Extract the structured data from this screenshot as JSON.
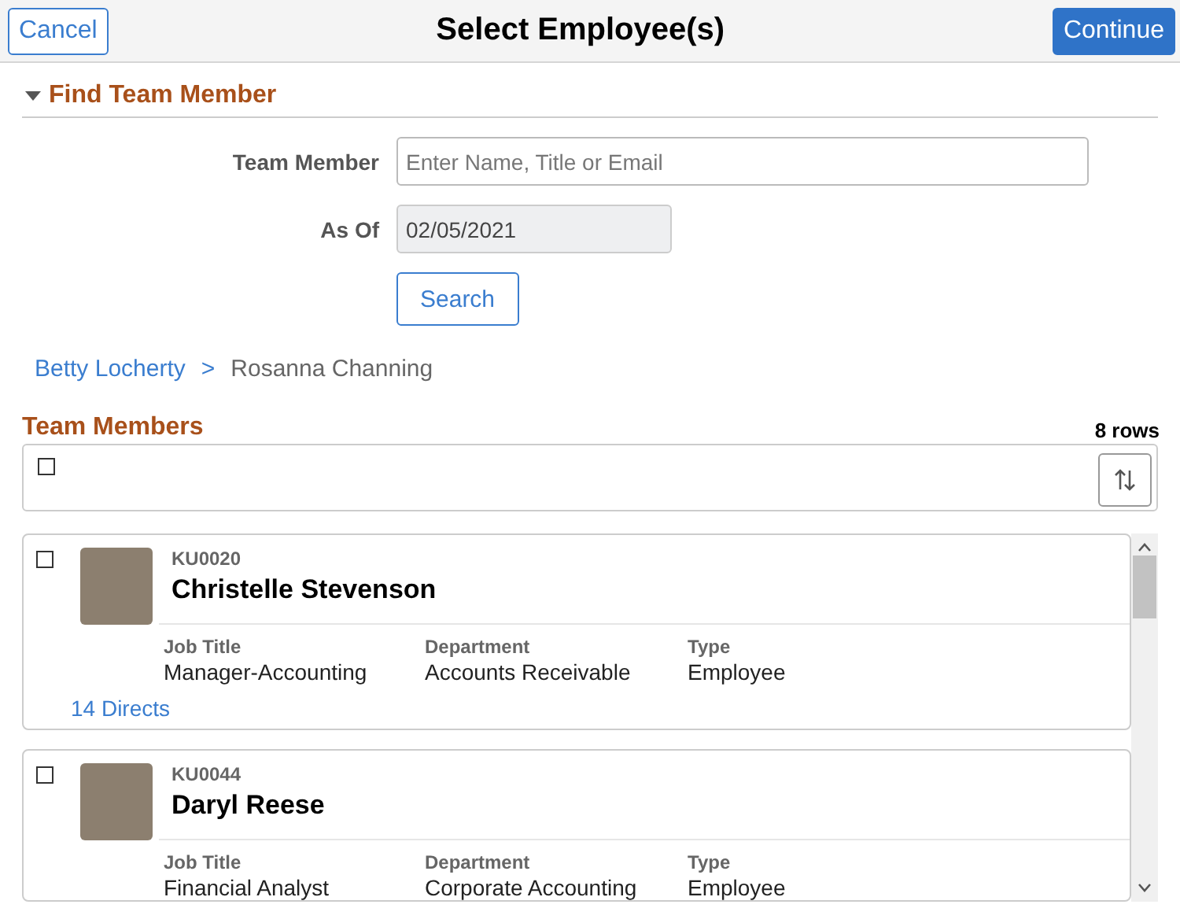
{
  "header": {
    "cancel": "Cancel",
    "title": "Select Employee(s)",
    "continue": "Continue"
  },
  "find_section": {
    "title": "Find Team Member",
    "expanded": true,
    "fields": [
      {
        "label": "Team Member",
        "placeholder": "Enter Name, Title or Email",
        "disabled": false
      },
      {
        "label": "As Of",
        "value": "02/05/2021",
        "disabled": true
      }
    ],
    "search_button": "Search"
  },
  "breadcrumb": [
    {
      "label": "Betty Locherty",
      "kind": "link"
    },
    {
      "label": "Rosanna Channing",
      "kind": "current"
    }
  ],
  "breadcrumb_separator": ">",
  "team_members": {
    "title": "Team Members",
    "row_count": "8 rows",
    "select_all_checked": false,
    "rows": [
      {
        "id": "KU0020",
        "name": "Christelle Stevenson",
        "checked": false,
        "details": [
          {
            "label": "Job Title",
            "value": "Manager-Accounting"
          },
          {
            "label": "Department",
            "value": "Accounts Receivable"
          },
          {
            "label": "Type",
            "value": "Employee"
          }
        ],
        "directs": "14 Directs"
      },
      {
        "id": "KU0044",
        "name": "Daryl Reese",
        "checked": false,
        "details": [
          {
            "label": "Job Title",
            "value": "Financial Analyst"
          },
          {
            "label": "Department",
            "value": "Corporate Accounting"
          },
          {
            "label": "Type",
            "value": "Employee"
          }
        ]
      }
    ]
  }
}
